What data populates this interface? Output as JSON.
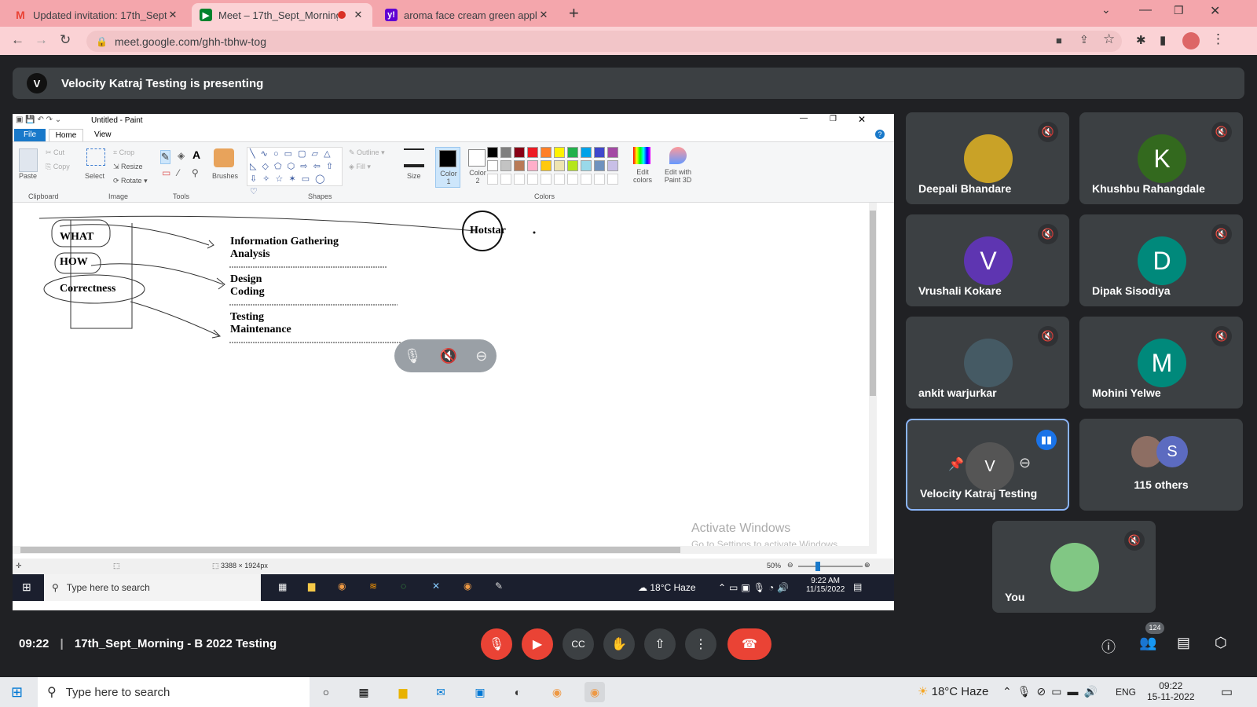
{
  "browser": {
    "tabs": [
      {
        "title": "Updated invitation: 17th_Sept_M",
        "icon": "gmail-icon"
      },
      {
        "title": "Meet – 17th_Sept_Morning -",
        "icon": "meet-icon"
      },
      {
        "title": "aroma face cream green apple -",
        "icon": "yahoo-icon"
      }
    ],
    "url": "meet.google.com/ghh-tbhw-tog"
  },
  "meet": {
    "presenting_text": "Velocity Katraj Testing is presenting",
    "time": "09:22",
    "meeting_title": "17th_Sept_Morning - B 2022 Testing",
    "people_count": "124",
    "participants": [
      {
        "name": "Deepali Bhandare",
        "initial": "",
        "color": "#c9a227"
      },
      {
        "name": "Khushbu Rahangdale",
        "initial": "K",
        "color": "#33691e"
      },
      {
        "name": "Vrushali Kokare",
        "initial": "V",
        "color": "#5e35b1"
      },
      {
        "name": "Dipak Sisodiya",
        "initial": "D",
        "color": "#00897b"
      },
      {
        "name": "ankit warjurkar",
        "initial": "",
        "color": "#455a64"
      },
      {
        "name": "Mohini Yelwe",
        "initial": "M",
        "color": "#00897b"
      },
      {
        "name": "Velocity Katraj Testing",
        "initial": "",
        "color": "#555"
      },
      {
        "name": "115 others",
        "initial": "S",
        "color": "#5c6bc0"
      },
      {
        "name": "You",
        "initial": "",
        "color": "#81c784"
      }
    ]
  },
  "paint": {
    "window_title": "Untitled - Paint",
    "menu": [
      "File",
      "Home",
      "View"
    ],
    "groups": [
      "Clipboard",
      "Image",
      "Tools",
      "Shapes",
      "Colors"
    ],
    "buttons": {
      "paste": "Paste",
      "cut": "Cut",
      "copy": "Copy",
      "select": "Select",
      "crop": "Crop",
      "resize": "Resize",
      "rotate": "Rotate",
      "brushes": "Brushes",
      "outline": "Outline",
      "fill": "Fill",
      "size": "Size",
      "color1": "Color 1",
      "color2": "Color 2",
      "edit_colors": "Edit colors",
      "edit_3d": "Edit with Paint 3D"
    },
    "palette": [
      "#000000",
      "#7f7f7f",
      "#880015",
      "#ed1c24",
      "#ff7f27",
      "#fff200",
      "#22b14c",
      "#00a2e8",
      "#3f48cc",
      "#a349a4",
      "#ffffff",
      "#c3c3c3",
      "#b97a57",
      "#ffaec9",
      "#ffc90e",
      "#efe4b0",
      "#b5e61d",
      "#99d9ea",
      "#7092be",
      "#c8bfe7"
    ],
    "canvas": {
      "labels": [
        "WHAT",
        "HOW",
        "Correctness",
        "Hotstar"
      ],
      "block1": [
        "Information Gathering",
        "Analysis"
      ],
      "block2": [
        "Design",
        "Coding"
      ],
      "block3": [
        "Testing",
        "Maintenance"
      ]
    },
    "status": {
      "size": "3388 × 1924px",
      "zoom": "50%"
    },
    "watermark": [
      "Activate Windows",
      "Go to Settings to activate Windows."
    ]
  },
  "inner_taskbar": {
    "search": "Type here to search",
    "weather": "18°C  Haze",
    "time": "9:22 AM",
    "date": "11/15/2022"
  },
  "taskbar": {
    "search": "Type here to search",
    "weather": "18°C  Haze",
    "lang": "ENG",
    "time": "09:22",
    "date": "15-11-2022"
  }
}
